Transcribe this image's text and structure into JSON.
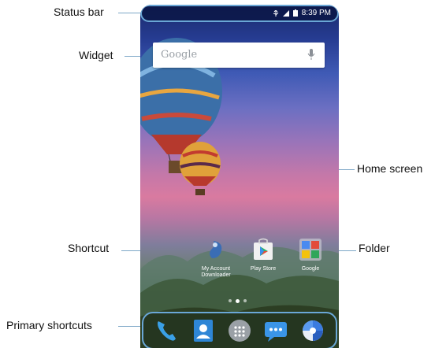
{
  "callouts": {
    "status_bar": "Status bar",
    "widget": "Widget",
    "home_screen": "Home screen",
    "shortcut": "Shortcut",
    "folder": "Folder",
    "primary_shortcuts": "Primary shortcuts"
  },
  "phone": {
    "status": {
      "time": "8:39 PM",
      "icons": [
        "usb-icon",
        "signal-icon",
        "battery-icon"
      ]
    },
    "search": {
      "placeholder": "Google",
      "icon": "mic-icon"
    },
    "apps": [
      {
        "label_line1": "My Account",
        "label_line2": "Downloader",
        "icon": "my-account-icon"
      },
      {
        "label_line1": "Play Store",
        "label_line2": "",
        "icon": "play-store-icon"
      },
      {
        "label_line1": "Google",
        "label_line2": "",
        "icon": "google-folder-icon"
      }
    ],
    "page_dots": {
      "count": 3,
      "active": 2
    },
    "dock": [
      "phone-icon",
      "contacts-icon",
      "app-drawer-icon",
      "messages-icon",
      "browser-icon"
    ]
  },
  "colors": {
    "callout_line": "#7da7c7",
    "highlight_border": "#6aa7d6"
  }
}
